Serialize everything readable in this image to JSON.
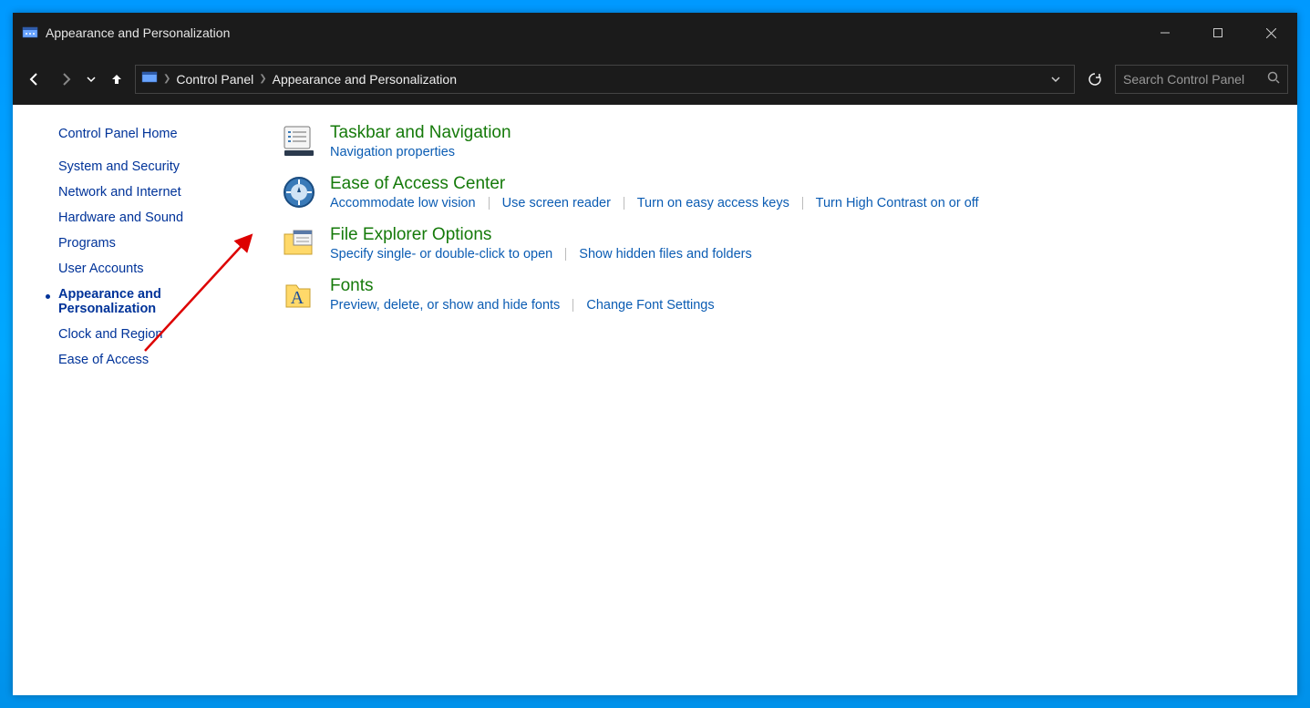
{
  "window": {
    "title": "Appearance and Personalization"
  },
  "breadcrumb": {
    "root": "Control Panel",
    "current": "Appearance and Personalization"
  },
  "search": {
    "placeholder": "Search Control Panel"
  },
  "sidebar": {
    "items": [
      {
        "label": "Control Panel Home",
        "active": false
      },
      {
        "label": "System and Security",
        "active": false
      },
      {
        "label": "Network and Internet",
        "active": false
      },
      {
        "label": "Hardware and Sound",
        "active": false
      },
      {
        "label": "Programs",
        "active": false
      },
      {
        "label": "User Accounts",
        "active": false
      },
      {
        "label": "Appearance and Personalization",
        "active": true
      },
      {
        "label": "Clock and Region",
        "active": false
      },
      {
        "label": "Ease of Access",
        "active": false
      }
    ]
  },
  "main": {
    "categories": [
      {
        "title": "Taskbar and Navigation",
        "links": [
          "Navigation properties"
        ]
      },
      {
        "title": "Ease of Access Center",
        "links": [
          "Accommodate low vision",
          "Use screen reader",
          "Turn on easy access keys",
          "Turn High Contrast on or off"
        ]
      },
      {
        "title": "File Explorer Options",
        "links": [
          "Specify single- or double-click to open",
          "Show hidden files and folders"
        ]
      },
      {
        "title": "Fonts",
        "links": [
          "Preview, delete, or show and hide fonts",
          "Change Font Settings"
        ]
      }
    ]
  }
}
